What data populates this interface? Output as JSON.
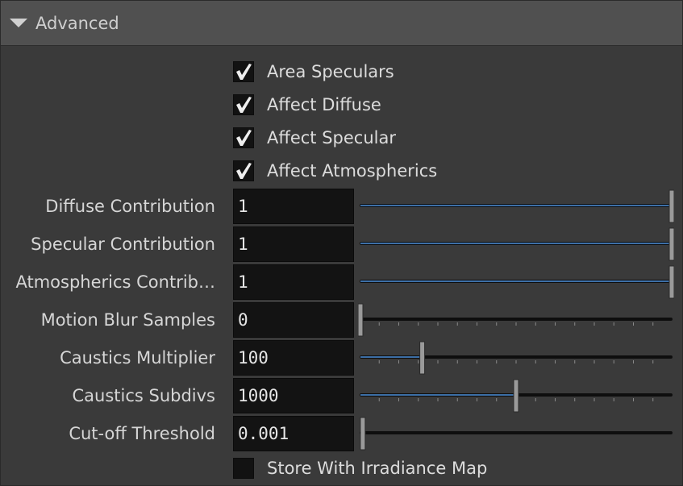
{
  "section": {
    "title": "Advanced"
  },
  "checkboxes": [
    {
      "label": "Area Speculars",
      "checked": true
    },
    {
      "label": "Affect Diffuse",
      "checked": true
    },
    {
      "label": "Affect Specular",
      "checked": true
    },
    {
      "label": "Affect Atmospherics",
      "checked": true
    }
  ],
  "params": [
    {
      "label": "Diffuse Contribution",
      "value": "1",
      "slider_fraction": 1.0,
      "ticks": false
    },
    {
      "label": "Specular Contribution",
      "value": "1",
      "slider_fraction": 1.0,
      "ticks": false
    },
    {
      "label": "Atmospherics Contrib…",
      "value": "1",
      "slider_fraction": 1.0,
      "ticks": false
    },
    {
      "label": "Motion Blur Samples",
      "value": "0",
      "slider_fraction": 0.0,
      "ticks": true
    },
    {
      "label": "Caustics Multiplier",
      "value": "100",
      "slider_fraction": 0.2,
      "ticks": true
    },
    {
      "label": "Caustics Subdivs",
      "value": "1000",
      "slider_fraction": 0.5,
      "ticks": true
    },
    {
      "label": "Cut-off Threshold",
      "value": "0.001",
      "slider_fraction": 0.01,
      "ticks": false
    }
  ],
  "bottom_checkbox": {
    "label": "Store With Irradiance Map",
    "checked": false
  },
  "colors": {
    "slider_fill": "#3d6fa6",
    "slider_track": "#0e0e0e",
    "handle": "#9a9a9a"
  }
}
